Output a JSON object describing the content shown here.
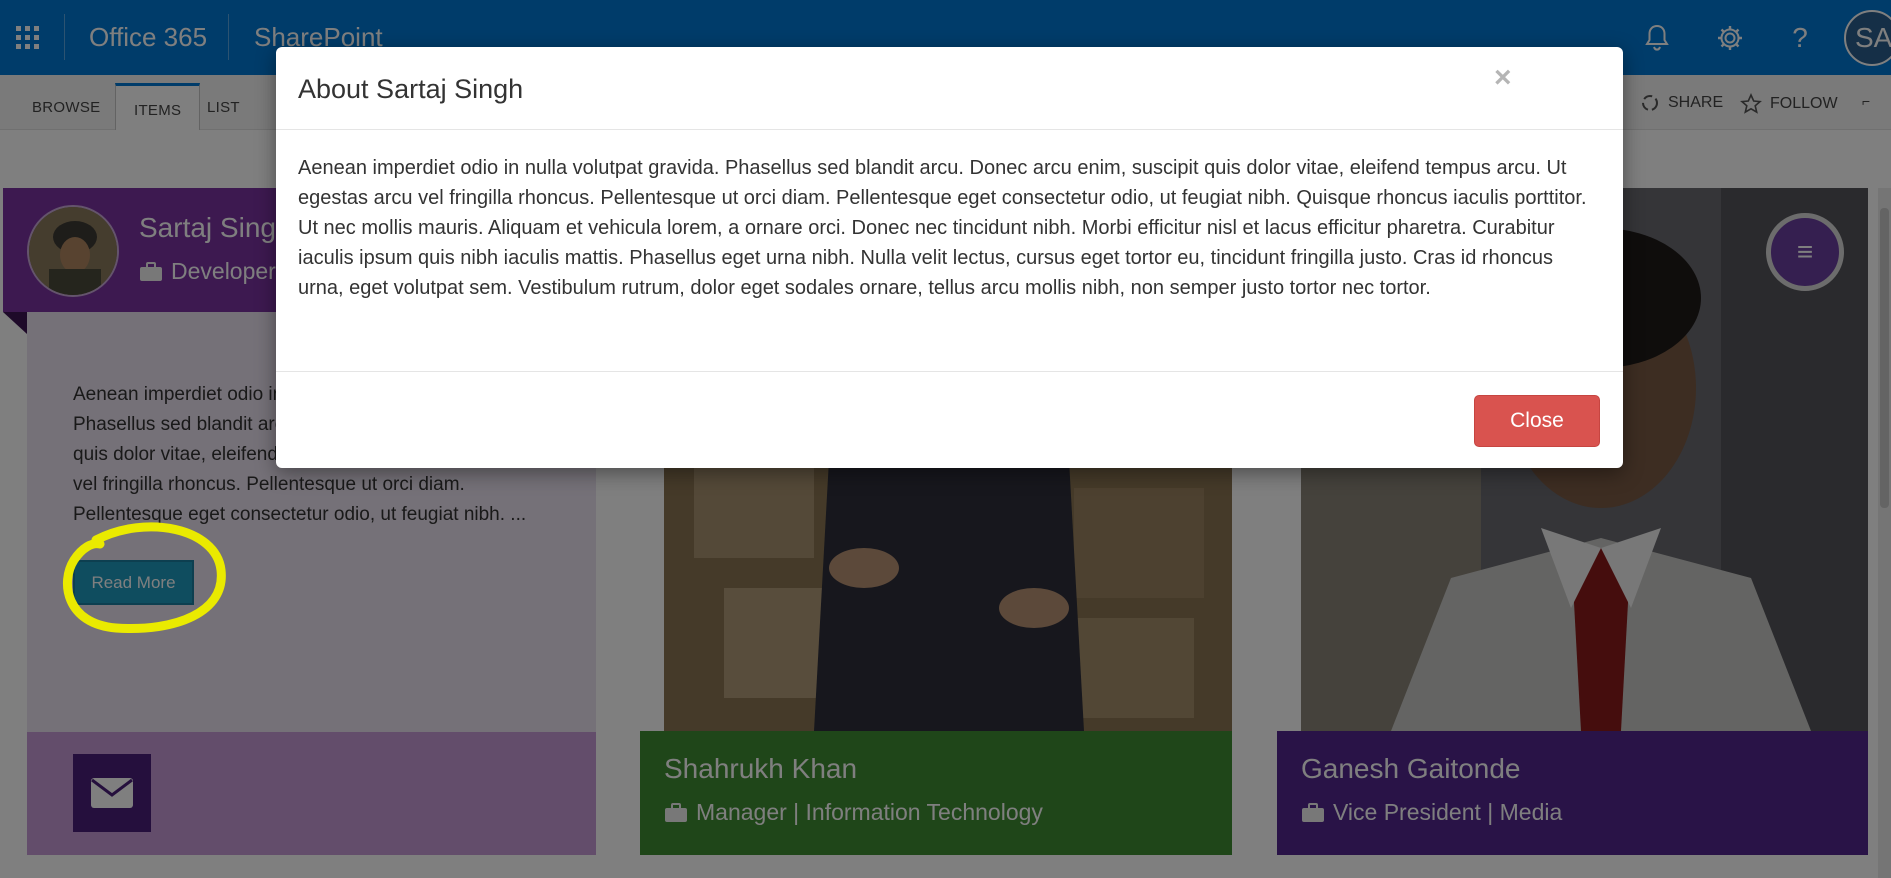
{
  "suite_bar": {
    "app_name": "Office 365",
    "site_name": "SharePoint",
    "user_initials": "SA",
    "icons": [
      "waffle-icon",
      "bell-icon",
      "gear-icon",
      "help-icon"
    ]
  },
  "ribbon": {
    "tabs": [
      "BROWSE",
      "ITEMS",
      "LIST"
    ],
    "active_tab": "ITEMS",
    "share_label": "SHARE",
    "follow_label": "FOLLOW"
  },
  "cards": [
    {
      "name": "Sartaj Singh",
      "role": "Developer",
      "excerpt": "Aenean imperdiet odio in nulla volutpat gravida. Phasellus sed blandit arcu. Donec arcu enim, suscipit quis dolor vitae, eleifend tempus arcu. Ut egestas arcu vel fringilla rhoncus. Pellentesque ut orci diam. Pellentesque eget consectetur odio, ut feugiat nibh. ...",
      "read_more_label": "Read More",
      "color": "#7a32a0"
    },
    {
      "name": "Shahrukh Khan",
      "role": "Manager | Information Technology",
      "color": "#3f8c32"
    },
    {
      "name": "Ganesh Gaitonde",
      "role": "Vice President | Media",
      "color": "#52268f"
    }
  ],
  "modal": {
    "title": "About Sartaj Singh",
    "body": "Aenean imperdiet odio in nulla volutpat gravida. Phasellus sed blandit arcu. Donec arcu enim, suscipit quis dolor vitae, eleifend tempus arcu. Ut egestas arcu vel fringilla rhoncus. Pellentesque ut orci diam. Pellentesque eget consectetur odio, ut feugiat nibh. Quisque rhoncus iaculis porttitor. Ut nec mollis mauris. Aliquam et vehicula lorem, a ornare orci. Donec nec tincidunt nibh. Morbi efficitur nisl et lacus efficitur pharetra. Curabitur iaculis ipsum quis nibh iaculis mattis. Phasellus eget urna nibh. Nulla velit lectus, cursus eget tortor eu, tincidunt fringilla justo. Cras id rhoncus urna, eget volutpat sem. Vestibulum rutrum, dolor eget sodales ornare, tellus arcu mollis nibh, non semper justo tortor nec tortor.",
    "close_x": "×",
    "close_button": "Close"
  },
  "colors": {
    "suite_blue": "#0078d4",
    "annotation_yellow": "#f2f200",
    "close_red": "#d9534f"
  }
}
